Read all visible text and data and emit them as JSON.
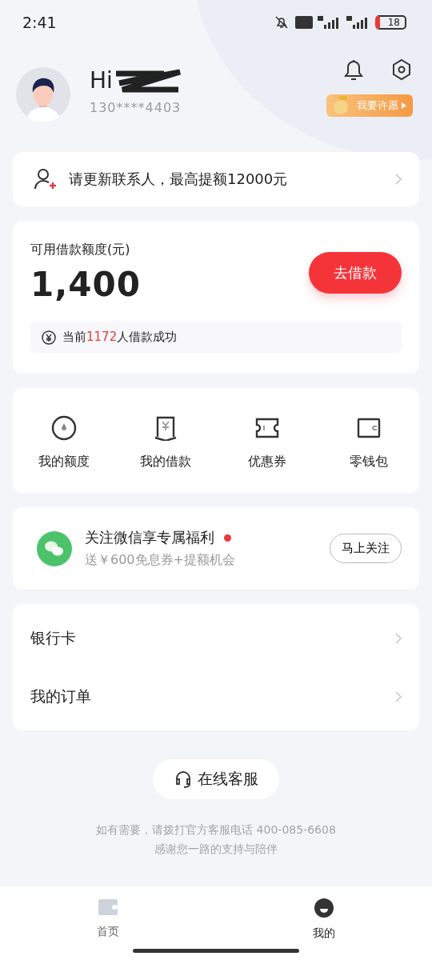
{
  "status_bar": {
    "time": "2:41",
    "battery": "18"
  },
  "profile": {
    "greeting": "Hi",
    "phone": "130****4403",
    "wish_badge": "我要许愿"
  },
  "contact_banner": {
    "text": "请更新联系人，最高提额12000元"
  },
  "credit": {
    "label": "可用借款额度(元)",
    "amount": "1,400",
    "button": "去借款",
    "notice_prefix": "当前",
    "notice_count": "1172",
    "notice_suffix": "人借款成功"
  },
  "shortcuts": [
    {
      "kind": "quota",
      "label": "我的额度"
    },
    {
      "kind": "loan",
      "label": "我的借款"
    },
    {
      "kind": "coupon",
      "label": "优惠券"
    },
    {
      "kind": "wallet",
      "label": "零钱包"
    }
  ],
  "wechat": {
    "title": "关注微信享专属福利",
    "subtitle": "送￥600免息券+提额机会",
    "button": "马上关注",
    "unread": true
  },
  "menu": [
    {
      "label": "银行卡"
    },
    {
      "label": "我的订单"
    }
  ],
  "service_button": "在线客服",
  "footer": [
    "如有需要，请拨打官方客服电话 400-085-6608",
    "感谢您一路的支持与陪伴"
  ],
  "tabs": [
    {
      "label": "首页",
      "selected": false
    },
    {
      "label": "我的",
      "selected": true
    }
  ]
}
